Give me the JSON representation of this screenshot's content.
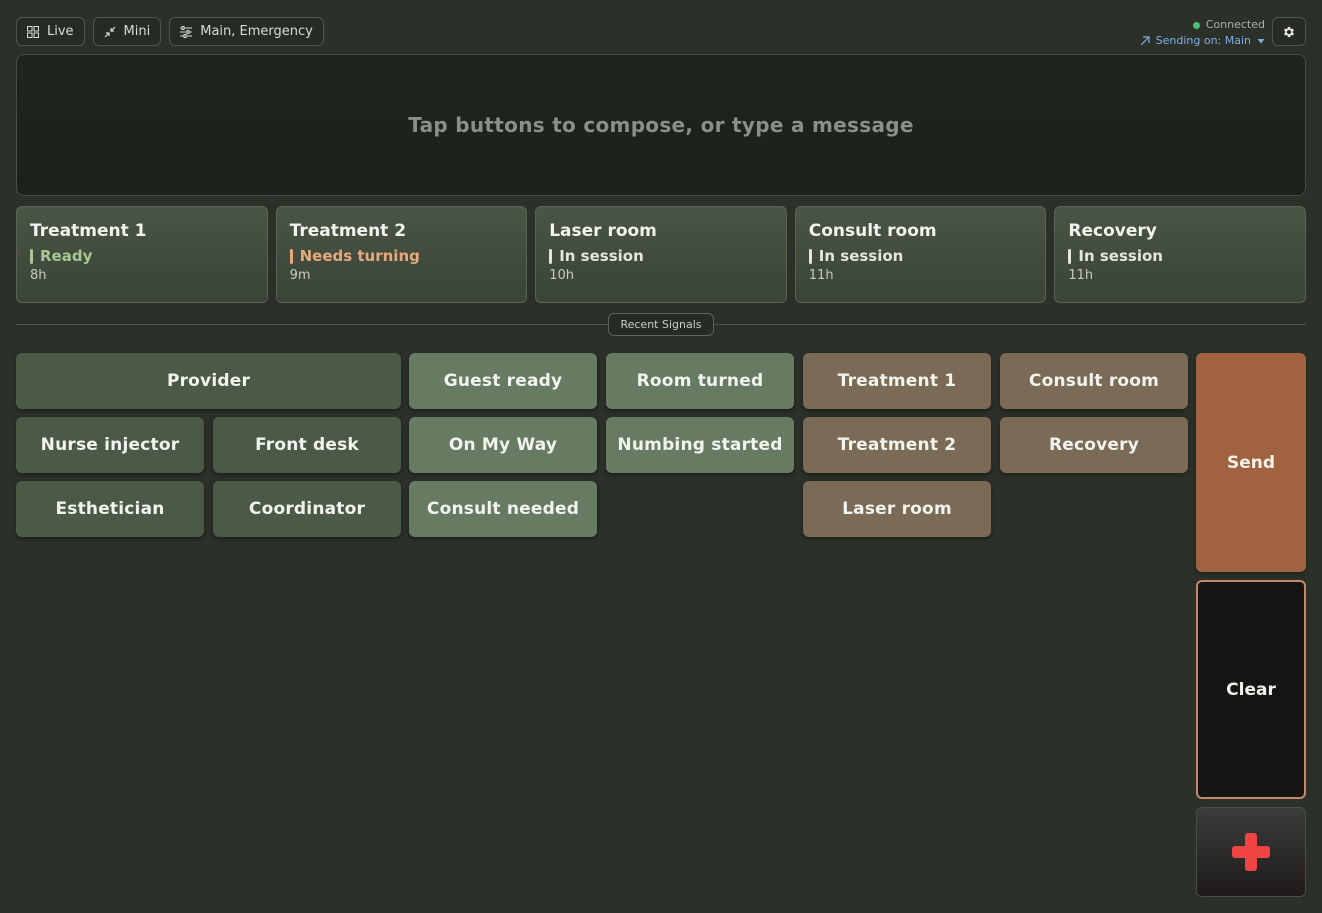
{
  "topbar": {
    "live_label": "Live",
    "mini_label": "Mini",
    "channels_label": "Main, Emergency"
  },
  "status": {
    "connection": "Connected",
    "sending": "Sending on: Main"
  },
  "compose": {
    "placeholder": "Tap buttons to compose, or type a message"
  },
  "rooms": [
    {
      "name": "Treatment 1",
      "status": "Ready",
      "status_color": "#a7c896",
      "time": "8h"
    },
    {
      "name": "Treatment 2",
      "status": "Needs turning",
      "status_color": "#e7a87d",
      "time": "9m"
    },
    {
      "name": "Laser room",
      "status": "In session",
      "status_color": "#e3e6df",
      "time": "10h"
    },
    {
      "name": "Consult room",
      "status": "In session",
      "status_color": "#e3e6df",
      "time": "11h"
    },
    {
      "name": "Recovery",
      "status": "In session",
      "status_color": "#e3e6df",
      "time": "11h"
    }
  ],
  "recent_signals_label": "Recent Signals",
  "people": {
    "provider": "Provider",
    "nurse_injector": "Nurse injector",
    "front_desk": "Front desk",
    "esthetician": "Esthetician",
    "coordinator": "Coordinator"
  },
  "signals": {
    "guest_ready": "Guest ready",
    "room_turned": "Room turned",
    "on_my_way": "On My Way",
    "numbing_started": "Numbing started",
    "consult_needed": "Consult needed"
  },
  "locations": {
    "treatment_1": "Treatment 1",
    "consult_room": "Consult room",
    "treatment_2": "Treatment 2",
    "recovery": "Recovery",
    "laser_room": "Laser room"
  },
  "actions": {
    "send": "Send",
    "clear": "Clear"
  },
  "colors": {
    "accent_send": "#a0623f",
    "emergency_cross": "#f04444",
    "connected_dot": "#4cc274"
  }
}
